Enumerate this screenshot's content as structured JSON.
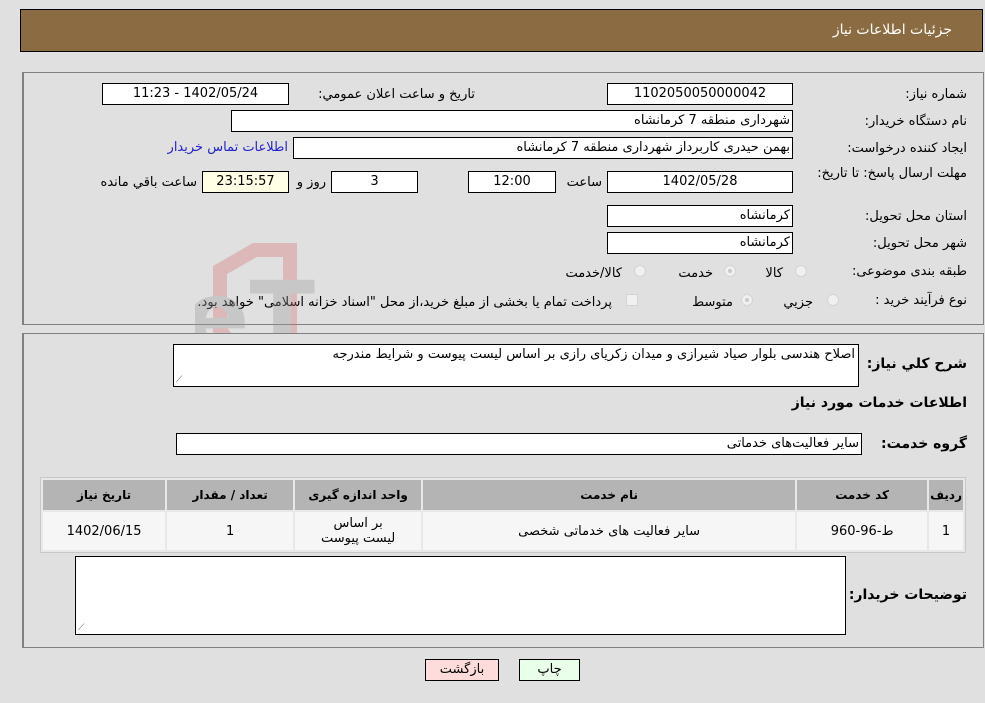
{
  "header": {
    "title": "جزئیات اطلاعات نیاز"
  },
  "details": {
    "need_number": {
      "label": "شماره نیاز:",
      "value": "1102050050000042"
    },
    "announce_datetime": {
      "label": "تاریخ و ساعت اعلان عمومي:",
      "value": "1402/05/24 - 11:23"
    },
    "buyer_org": {
      "label": "نام دستگاه خریدار:",
      "value": "شهرداری منطقه 7 کرمانشاه"
    },
    "requester": {
      "label": "ایجاد کننده درخواست:",
      "value": "بهمن حیدری کاربرداز شهرداری منطقه 7 کرمانشاه",
      "contact_link": "اطلاعات تماس خریدار"
    },
    "deadline": {
      "label": "مهلت ارسال پاسخ: تا تاریخ:",
      "date": "1402/05/28",
      "time_label": "ساعت",
      "time": "12:00",
      "days": "3",
      "days_label": "روز و",
      "remaining": "23:15:57",
      "remaining_label": "ساعت باقي مانده"
    },
    "province": {
      "label": "استان محل تحویل:",
      "value": "کرمانشاه"
    },
    "city": {
      "label": "شهر محل تحویل:",
      "value": "کرمانشاه"
    },
    "category": {
      "label": "طبقه بندی موضوعی:",
      "options": [
        "کالا",
        "خدمت",
        "کالا/خدمت"
      ],
      "selected": "خدمت"
    },
    "purchase_type": {
      "label": "نوع فرآیند خرید :",
      "options": [
        "جزيي",
        "متوسط"
      ],
      "selected": "متوسط",
      "treasury_note": "پرداخت تمام یا بخشی از مبلغ خرید،از محل \"اسناد خزانه اسلامی\" خواهد بود."
    }
  },
  "description": {
    "label": "شرح کلي نیاز:",
    "value": "اصلاح هندسی بلوار صیاد شیرازی و میدان زکریای رازی بر اساس لیست پیوست و شرایط مندرجه"
  },
  "services": {
    "section_title": "اطلاعات خدمات مورد نیاز",
    "group_label": "گروه خدمت:",
    "group_value": "سایر فعالیت‌های خدماتی",
    "table": {
      "headers": [
        "ردیف",
        "کد خدمت",
        "نام خدمت",
        "واحد اندازه گیری",
        "تعداد / مقدار",
        "تاریخ نیاز"
      ],
      "rows": [
        [
          "1",
          "ط-96-960",
          "سایر فعالیت های خدماتی شخصی",
          "بر اساس لیست پیوست",
          "1",
          "1402/06/15"
        ]
      ]
    }
  },
  "buyer_notes": {
    "label": "توضیحات خریدار:",
    "value": ""
  },
  "buttons": {
    "print": "چاپ",
    "back": "بازگشت"
  },
  "watermark": {
    "text": "AriaTender.neT"
  },
  "colors": {
    "header_bg": "#8b6c42",
    "print_bg": "#eaffea",
    "back_bg": "#ffdcdc",
    "link": "#2222cc"
  }
}
